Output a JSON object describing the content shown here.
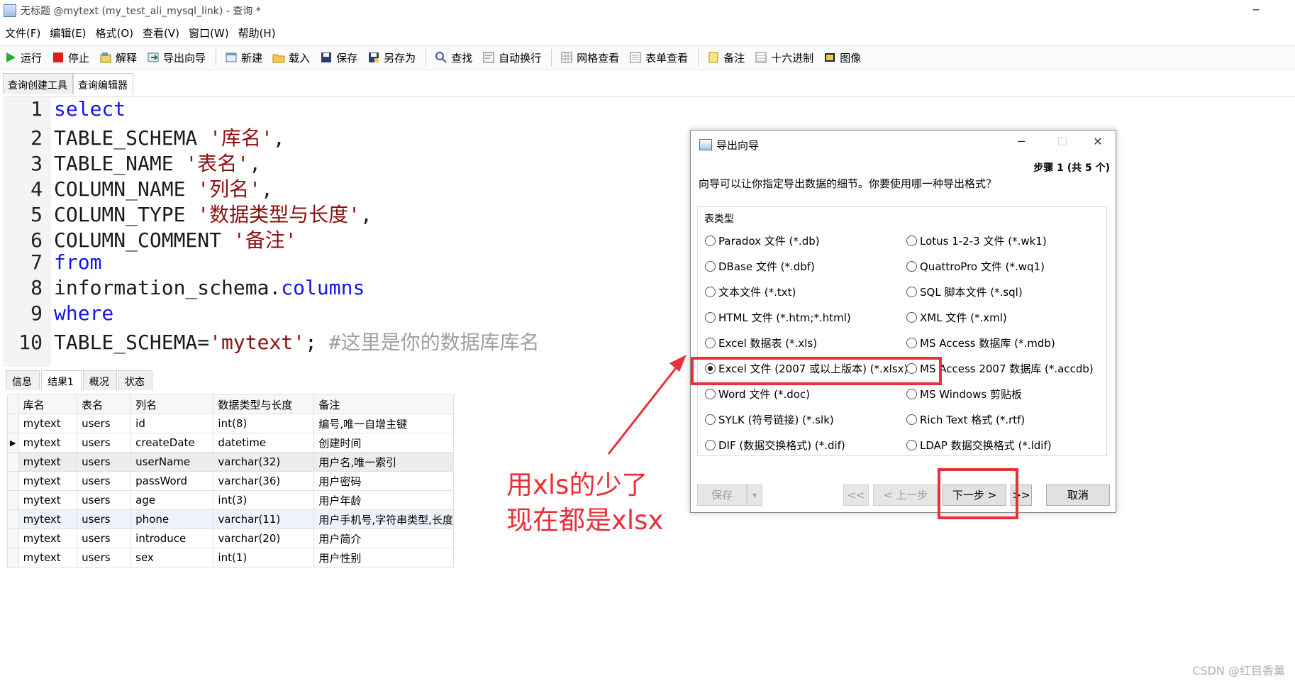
{
  "window": {
    "title": "无标题 @mytext (my_test_ali_mysql_link) - 查询 *",
    "minimize": "─"
  },
  "menu": [
    "文件(F)",
    "编辑(E)",
    "格式(O)",
    "查看(V)",
    "窗口(W)",
    "帮助(H)"
  ],
  "toolbar": {
    "run": "运行",
    "stop": "停止",
    "explain": "解释",
    "export_wizard": "导出向导",
    "new": "新建",
    "load": "载入",
    "save": "保存",
    "save_as": "另存为",
    "find": "查找",
    "word_wrap": "自动换行",
    "grid_view": "网格查看",
    "form_view": "表单查看",
    "memo": "备注",
    "hex": "十六进制",
    "image": "图像"
  },
  "editor_tabs": [
    "查询创建工具",
    "查询编辑器"
  ],
  "editor": {
    "line_numbers": [
      "1",
      "2",
      "3",
      "4",
      "5",
      "6",
      "7",
      "8",
      "9",
      "10"
    ],
    "l1": "select",
    "l2_a": "TABLE_SCHEMA ",
    "l2_s": "'库名'",
    "l2_b": ",",
    "l3_a": "TABLE_NAME ",
    "l3_s": "'表名'",
    "l3_b": ",",
    "l4_a": "COLUMN_NAME ",
    "l4_s": "'列名'",
    "l4_b": ",",
    "l5_a": "COLUMN_TYPE ",
    "l5_s": "'数据类型与长度'",
    "l5_b": ",",
    "l6_a": "COLUMN_COMMENT ",
    "l6_s": "'备注'",
    "l7": "from",
    "l8_a": "information_schema.",
    "l8_k": "columns",
    "l9": "where",
    "l10_a": "TABLE_SCHEMA=",
    "l10_s": "'mytext'",
    "l10_b": "; ",
    "l10_c": "#这里是你的数据库库名"
  },
  "result_tabs": [
    "信息",
    "结果1",
    "概况",
    "状态"
  ],
  "grid": {
    "columns": [
      "库名",
      "表名",
      "列名",
      "数据类型与长度",
      "备注"
    ],
    "current_marker": "▶",
    "rows": [
      [
        "mytext",
        "users",
        "id",
        "int(8)",
        "编号,唯一自增主键"
      ],
      [
        "mytext",
        "users",
        "createDate",
        "datetime",
        "创建时间"
      ],
      [
        "mytext",
        "users",
        "userName",
        "varchar(32)",
        "用户名,唯一索引"
      ],
      [
        "mytext",
        "users",
        "passWord",
        "varchar(36)",
        "用户密码"
      ],
      [
        "mytext",
        "users",
        "age",
        "int(3)",
        "用户年龄"
      ],
      [
        "mytext",
        "users",
        "phone",
        "varchar(11)",
        "用户手机号,字符串类型,长度"
      ],
      [
        "mytext",
        "users",
        "introduce",
        "varchar(20)",
        "用户简介"
      ],
      [
        "mytext",
        "users",
        "sex",
        "int(1)",
        "用户性别"
      ]
    ]
  },
  "dialog": {
    "title": "导出向导",
    "minimize": "─",
    "maximize": "☐",
    "close": "✕",
    "step": "步骤 1 (共 5 个)",
    "instruction": "向导可以让你指定导出数据的细节。你要使用哪一种导出格式？",
    "group_label": "表类型",
    "options_left": [
      "Paradox 文件 (*.db)",
      "DBase 文件 (*.dbf)",
      "文本文件 (*.txt)",
      "HTML 文件 (*.htm;*.html)",
      "Excel 数据表 (*.xls)",
      "Excel 文件 (2007 或以上版本) (*.xlsx)",
      "Word 文件 (*.doc)",
      "SYLK (符号链接) (*.slk)",
      "DIF (数据交换格式) (*.dif)"
    ],
    "options_right": [
      "Lotus 1-2-3 文件 (*.wk1)",
      "QuattroPro 文件 (*.wq1)",
      "SQL 脚本文件 (*.sql)",
      "XML 文件 (*.xml)",
      "MS Access 数据库 (*.mdb)",
      "MS Access 2007 数据库 (*.accdb)",
      "MS Windows 剪贴板",
      "Rich Text 格式 (*.rtf)",
      "LDAP 数据交换格式 (*.ldif)"
    ],
    "selected_option": "Excel 文件 (2007 或以上版本) (*.xlsx)",
    "buttons": {
      "save": "保存",
      "save_dropdown": "▾",
      "first": "<<",
      "prev": "< 上一步",
      "next": "下一步 >",
      "last": ">>",
      "cancel": "取消"
    }
  },
  "annotation": {
    "line1": "用xls的少了",
    "line2": "现在都是xlsx",
    "color": "#e8303a"
  },
  "watermark": "CSDN @红目香薰"
}
